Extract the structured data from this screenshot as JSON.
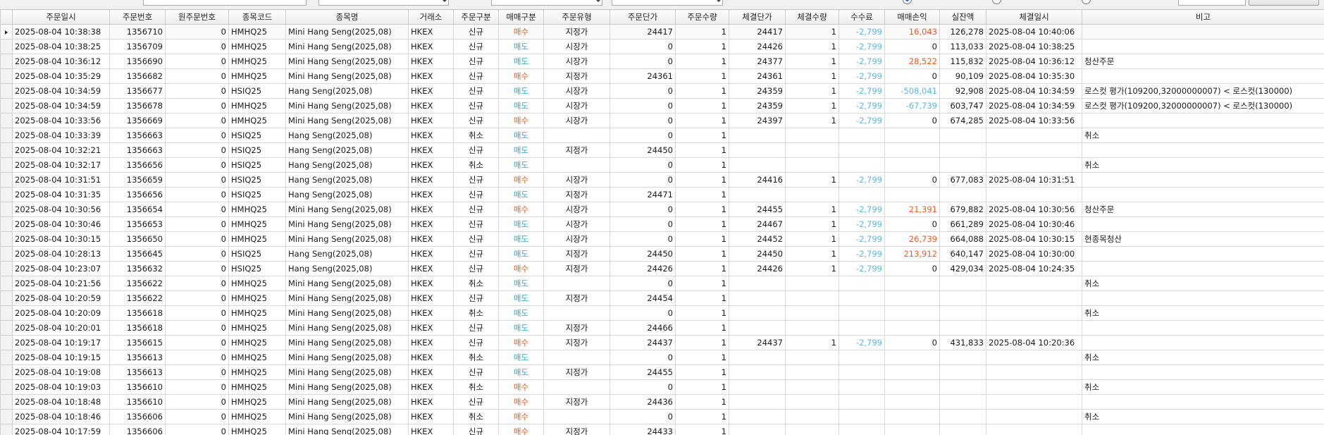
{
  "colors": {
    "buy": "#f05a22",
    "sell": "#2aa7d8",
    "negative": "#5db7e0",
    "positive": "#f05a22"
  },
  "columns": [
    "주문일시",
    "주문번호",
    "원주문번호",
    "종목코드",
    "종목명",
    "거래소",
    "주문구분",
    "매매구분",
    "주문유형",
    "주문단가",
    "주문수량",
    "체결단가",
    "체결수량",
    "수수료",
    "매매손익",
    "실잔액",
    "체결일시",
    "비고"
  ],
  "rows": [
    [
      "2025-08-04 10:38:38",
      "1356710",
      "0",
      "HMHQ25",
      "Mini Hang Seng(2025,08)",
      "HKEX",
      "신규",
      "매수",
      "지정가",
      "24417",
      "1",
      "24417",
      "1",
      "-2,799",
      "16,043",
      "126,278",
      "2025-08-04 10:40:06",
      ""
    ],
    [
      "2025-08-04 10:38:25",
      "1356709",
      "0",
      "HMHQ25",
      "Mini Hang Seng(2025,08)",
      "HKEX",
      "신규",
      "매도",
      "시장가",
      "0",
      "1",
      "24426",
      "1",
      "-2,799",
      "0",
      "113,033",
      "2025-08-04 10:38:25",
      ""
    ],
    [
      "2025-08-04 10:36:12",
      "1356690",
      "0",
      "HMHQ25",
      "Mini Hang Seng(2025,08)",
      "HKEX",
      "신규",
      "매도",
      "시장가",
      "0",
      "1",
      "24377",
      "1",
      "-2,799",
      "28,522",
      "115,832",
      "2025-08-04 10:36:12",
      "청산주문"
    ],
    [
      "2025-08-04 10:35:29",
      "1356682",
      "0",
      "HMHQ25",
      "Mini Hang Seng(2025,08)",
      "HKEX",
      "신규",
      "매수",
      "지정가",
      "24361",
      "1",
      "24361",
      "1",
      "-2,799",
      "0",
      "90,109",
      "2025-08-04 10:35:30",
      ""
    ],
    [
      "2025-08-04 10:34:59",
      "1356677",
      "0",
      "HSIQ25",
      "Hang Seng(2025,08)",
      "HKEX",
      "신규",
      "매도",
      "시장가",
      "0",
      "1",
      "24359",
      "1",
      "-2,799",
      "-508,041",
      "92,908",
      "2025-08-04 10:34:59",
      "로스컷 평가(109200,32000000007) < 로스컷(130000)"
    ],
    [
      "2025-08-04 10:34:59",
      "1356678",
      "0",
      "HMHQ25",
      "Mini Hang Seng(2025,08)",
      "HKEX",
      "신규",
      "매도",
      "시장가",
      "0",
      "1",
      "24359",
      "1",
      "-2,799",
      "-67,739",
      "603,747",
      "2025-08-04 10:34:59",
      "로스컷 평가(109200,32000000007) < 로스컷(130000)"
    ],
    [
      "2025-08-04 10:33:56",
      "1356669",
      "0",
      "HMHQ25",
      "Mini Hang Seng(2025,08)",
      "HKEX",
      "신규",
      "매수",
      "시장가",
      "0",
      "1",
      "24397",
      "1",
      "-2,799",
      "0",
      "674,285",
      "2025-08-04 10:33:56",
      ""
    ],
    [
      "2025-08-04 10:33:39",
      "1356663",
      "0",
      "HSIQ25",
      "Hang Seng(2025,08)",
      "HKEX",
      "취소",
      "매도",
      "",
      "0",
      "1",
      "",
      "",
      "",
      "",
      "",
      "",
      "취소"
    ],
    [
      "2025-08-04 10:32:21",
      "1356663",
      "0",
      "HSIQ25",
      "Hang Seng(2025,08)",
      "HKEX",
      "신규",
      "매도",
      "지정가",
      "24450",
      "1",
      "",
      "",
      "",
      "",
      "",
      "",
      ""
    ],
    [
      "2025-08-04 10:32:17",
      "1356656",
      "0",
      "HSIQ25",
      "Hang Seng(2025,08)",
      "HKEX",
      "취소",
      "매도",
      "",
      "0",
      "1",
      "",
      "",
      "",
      "",
      "",
      "",
      "취소"
    ],
    [
      "2025-08-04 10:31:51",
      "1356659",
      "0",
      "HSIQ25",
      "Hang Seng(2025,08)",
      "HKEX",
      "신규",
      "매수",
      "시장가",
      "0",
      "1",
      "24416",
      "1",
      "-2,799",
      "0",
      "677,083",
      "2025-08-04 10:31:51",
      ""
    ],
    [
      "2025-08-04 10:31:35",
      "1356656",
      "0",
      "HSIQ25",
      "Hang Seng(2025,08)",
      "HKEX",
      "신규",
      "매도",
      "지정가",
      "24471",
      "1",
      "",
      "",
      "",
      "",
      "",
      "",
      ""
    ],
    [
      "2025-08-04 10:30:56",
      "1356654",
      "0",
      "HMHQ25",
      "Mini Hang Seng(2025,08)",
      "HKEX",
      "신규",
      "매수",
      "시장가",
      "0",
      "1",
      "24455",
      "1",
      "-2,799",
      "21,391",
      "679,882",
      "2025-08-04 10:30:56",
      "청산주문"
    ],
    [
      "2025-08-04 10:30:46",
      "1356653",
      "0",
      "HMHQ25",
      "Mini Hang Seng(2025,08)",
      "HKEX",
      "신규",
      "매도",
      "시장가",
      "0",
      "1",
      "24467",
      "1",
      "-2,799",
      "0",
      "661,289",
      "2025-08-04 10:30:46",
      ""
    ],
    [
      "2025-08-04 10:30:15",
      "1356650",
      "0",
      "HMHQ25",
      "Mini Hang Seng(2025,08)",
      "HKEX",
      "신규",
      "매도",
      "시장가",
      "0",
      "1",
      "24452",
      "1",
      "-2,799",
      "26,739",
      "664,088",
      "2025-08-04 10:30:15",
      "현종목청산"
    ],
    [
      "2025-08-04 10:28:13",
      "1356645",
      "0",
      "HSIQ25",
      "Hang Seng(2025,08)",
      "HKEX",
      "신규",
      "매도",
      "지정가",
      "24450",
      "1",
      "24450",
      "1",
      "-2,799",
      "213,912",
      "640,147",
      "2025-08-04 10:30:00",
      ""
    ],
    [
      "2025-08-04 10:23:07",
      "1356632",
      "0",
      "HSIQ25",
      "Hang Seng(2025,08)",
      "HKEX",
      "신규",
      "매수",
      "지정가",
      "24426",
      "1",
      "24426",
      "1",
      "-2,799",
      "0",
      "429,034",
      "2025-08-04 10:24:35",
      ""
    ],
    [
      "2025-08-04 10:21:56",
      "1356622",
      "0",
      "HMHQ25",
      "Mini Hang Seng(2025,08)",
      "HKEX",
      "취소",
      "매도",
      "",
      "0",
      "1",
      "",
      "",
      "",
      "",
      "",
      "",
      "취소"
    ],
    [
      "2025-08-04 10:20:59",
      "1356622",
      "0",
      "HMHQ25",
      "Mini Hang Seng(2025,08)",
      "HKEX",
      "신규",
      "매도",
      "지정가",
      "24454",
      "1",
      "",
      "",
      "",
      "",
      "",
      "",
      ""
    ],
    [
      "2025-08-04 10:20:09",
      "1356618",
      "0",
      "HMHQ25",
      "Mini Hang Seng(2025,08)",
      "HKEX",
      "취소",
      "매도",
      "",
      "0",
      "1",
      "",
      "",
      "",
      "",
      "",
      "",
      "취소"
    ],
    [
      "2025-08-04 10:20:01",
      "1356618",
      "0",
      "HMHQ25",
      "Mini Hang Seng(2025,08)",
      "HKEX",
      "신규",
      "매도",
      "지정가",
      "24466",
      "1",
      "",
      "",
      "",
      "",
      "",
      "",
      ""
    ],
    [
      "2025-08-04 10:19:17",
      "1356615",
      "0",
      "HMHQ25",
      "Mini Hang Seng(2025,08)",
      "HKEX",
      "신규",
      "매수",
      "지정가",
      "24437",
      "1",
      "24437",
      "1",
      "-2,799",
      "0",
      "431,833",
      "2025-08-04 10:20:36",
      ""
    ],
    [
      "2025-08-04 10:19:15",
      "1356613",
      "0",
      "HMHQ25",
      "Mini Hang Seng(2025,08)",
      "HKEX",
      "취소",
      "매도",
      "",
      "0",
      "1",
      "",
      "",
      "",
      "",
      "",
      "",
      "취소"
    ],
    [
      "2025-08-04 10:19:08",
      "1356613",
      "0",
      "HMHQ25",
      "Mini Hang Seng(2025,08)",
      "HKEX",
      "신규",
      "매도",
      "지정가",
      "24455",
      "1",
      "",
      "",
      "",
      "",
      "",
      "",
      ""
    ],
    [
      "2025-08-04 10:19:03",
      "1356610",
      "0",
      "HMHQ25",
      "Mini Hang Seng(2025,08)",
      "HKEX",
      "취소",
      "매수",
      "",
      "0",
      "1",
      "",
      "",
      "",
      "",
      "",
      "",
      "취소"
    ],
    [
      "2025-08-04 10:18:48",
      "1356610",
      "0",
      "HMHQ25",
      "Mini Hang Seng(2025,08)",
      "HKEX",
      "신규",
      "매수",
      "지정가",
      "24436",
      "1",
      "",
      "",
      "",
      "",
      "",
      "",
      ""
    ],
    [
      "2025-08-04 10:18:46",
      "1356606",
      "0",
      "HMHQ25",
      "Mini Hang Seng(2025,08)",
      "HKEX",
      "취소",
      "매수",
      "",
      "0",
      "1",
      "",
      "",
      "",
      "",
      "",
      "",
      "취소"
    ],
    [
      "2025-08-04 10:17:59",
      "1356606",
      "0",
      "HMHQ25",
      "Mini Hang Seng(2025,08)",
      "HKEX",
      "신규",
      "매수",
      "지정가",
      "24433",
      "1",
      "",
      "",
      "",
      "",
      "",
      "",
      ""
    ]
  ]
}
